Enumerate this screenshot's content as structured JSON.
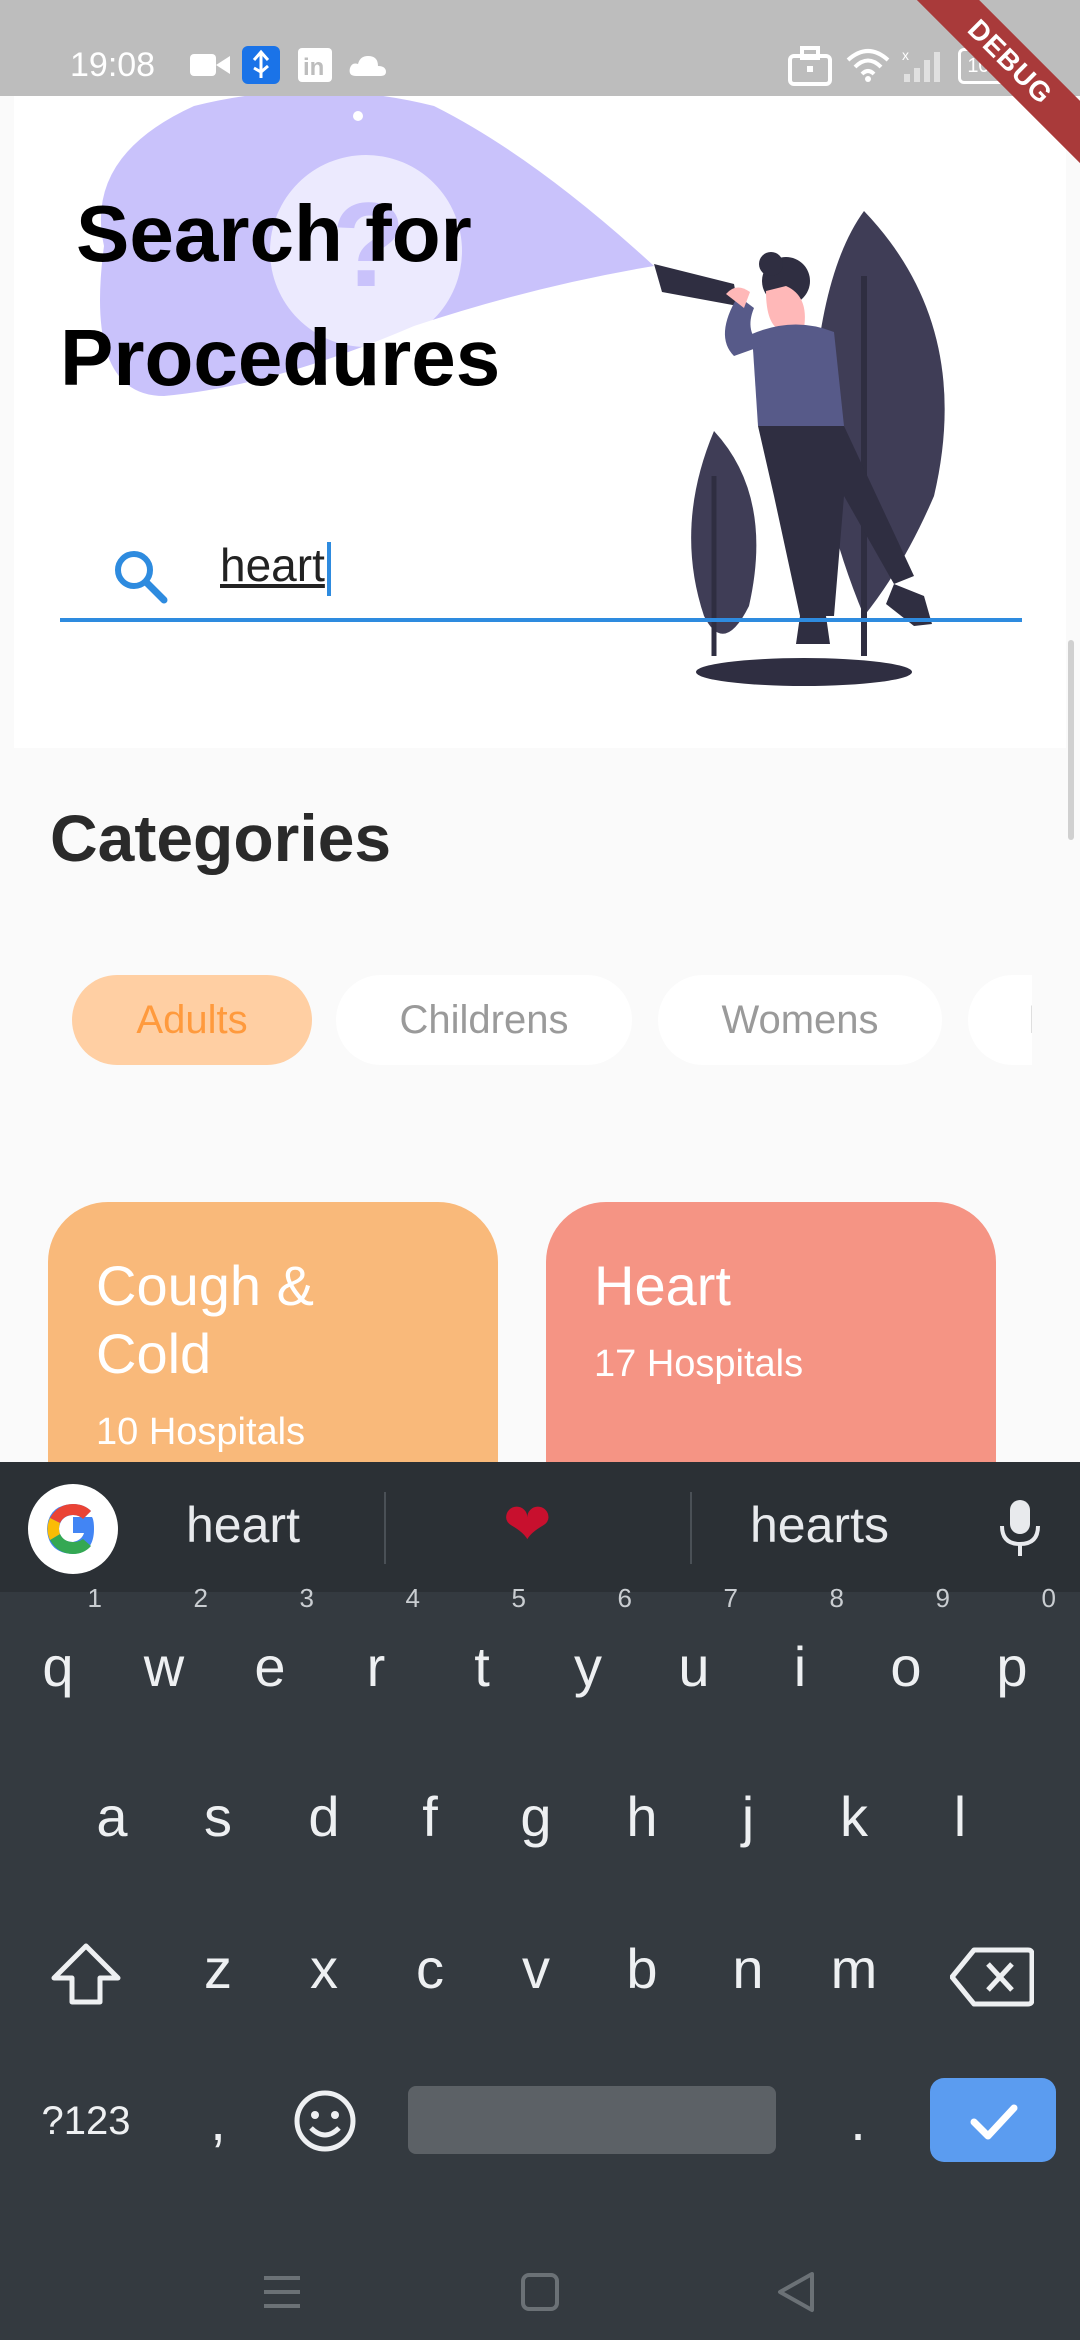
{
  "status_bar": {
    "time": "19:08",
    "battery": "100",
    "debug_banner": "DEBUG",
    "icons": [
      "video-icon",
      "usb-icon",
      "linkedin-icon",
      "cloud-icon",
      "briefcase-icon",
      "wifi-icon",
      "signal-icon",
      "battery-icon"
    ]
  },
  "header": {
    "title_line1": "Search for",
    "title_line2": "Procedures",
    "search": {
      "value": "heart",
      "icon": "search-icon"
    }
  },
  "categories": {
    "heading": "Categories",
    "chips": [
      {
        "label": "Adults",
        "active": true
      },
      {
        "label": "Childrens",
        "active": false
      },
      {
        "label": "Womens",
        "active": false
      },
      {
        "label": "I",
        "active": false
      }
    ]
  },
  "cards": [
    {
      "title": "Cough & Cold",
      "subtitle": "10 Hospitals",
      "color": "#f9b97a"
    },
    {
      "title": "Heart",
      "subtitle": "17 Hospitals",
      "color": "#f59484"
    }
  ],
  "keyboard": {
    "suggestions": [
      "heart",
      "❤",
      "hearts"
    ],
    "row1": [
      {
        "key": "q",
        "hint": "1"
      },
      {
        "key": "w",
        "hint": "2"
      },
      {
        "key": "e",
        "hint": "3"
      },
      {
        "key": "r",
        "hint": "4"
      },
      {
        "key": "t",
        "hint": "5"
      },
      {
        "key": "y",
        "hint": "6"
      },
      {
        "key": "u",
        "hint": "7"
      },
      {
        "key": "i",
        "hint": "8"
      },
      {
        "key": "o",
        "hint": "9"
      },
      {
        "key": "p",
        "hint": "0"
      }
    ],
    "row2": [
      "a",
      "s",
      "d",
      "f",
      "g",
      "h",
      "j",
      "k",
      "l"
    ],
    "row3": [
      "z",
      "x",
      "c",
      "v",
      "b",
      "n",
      "m"
    ],
    "symbols_key": "?123",
    "comma_key": ",",
    "period_key": "."
  },
  "colors": {
    "accent": "#2e8bdf",
    "chip_active_bg": "#ffcfa3",
    "chip_active_text": "#ff9a3d",
    "keyboard_bg": "#343a40",
    "enter_key": "#5b9cf0"
  }
}
